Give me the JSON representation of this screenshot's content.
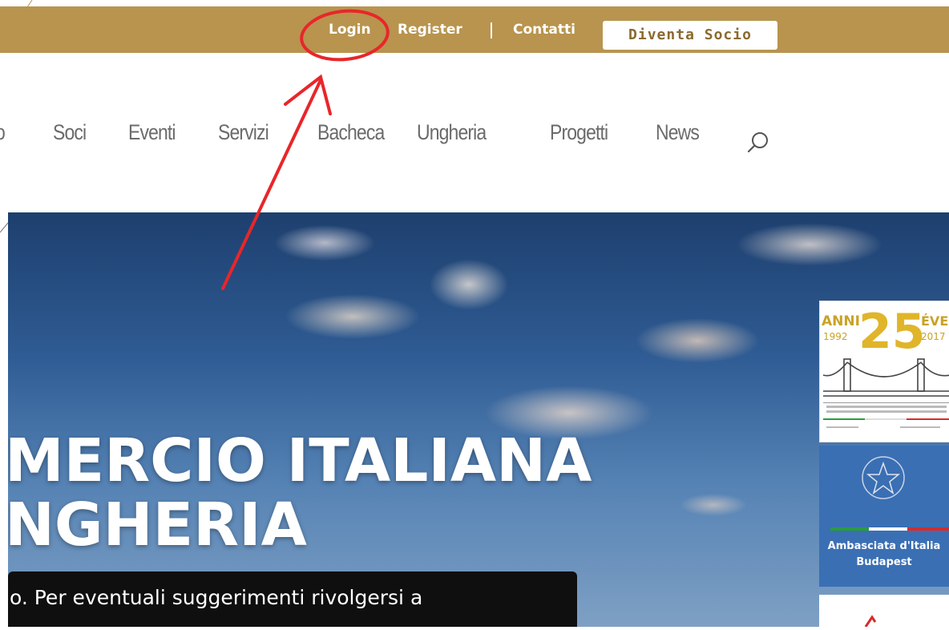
{
  "topbar": {
    "login": "Login",
    "register": "Register",
    "contatti": "Contatti",
    "cta": "Diventa Socio"
  },
  "nav": {
    "cut_item": "o",
    "items": [
      "Soci",
      "Eventi",
      "Servizi",
      "Bacheca",
      "Ungheria",
      "Progetti",
      "News"
    ]
  },
  "hero": {
    "title_line1": "MERCIO ITALIANA",
    "title_line2": "NGHERIA",
    "caption": "o. Per eventuali suggerimenti rivolgersi a"
  },
  "badge25": {
    "anni": "ANNI",
    "number": "25",
    "year_start": "1992",
    "evek": "ÉVE",
    "year_end": "2017"
  },
  "embassy": {
    "line1": "Ambasciata d'Italia",
    "line2": "Budapest"
  },
  "colors": {
    "topbar": "#b8944f",
    "annotation": "#e8262a",
    "embassy": "#3a6fb4"
  }
}
